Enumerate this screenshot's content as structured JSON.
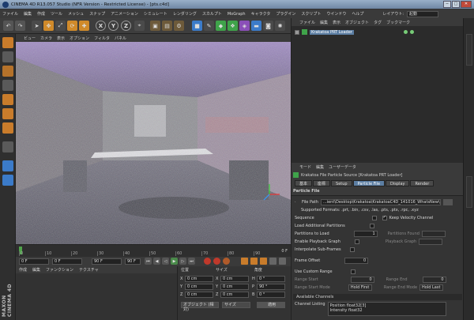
{
  "window": {
    "title": "CINEMA 4D R13.057 Studio (NFR Version - Restricted License) - [pts.c4d]",
    "min": "─",
    "max": "□",
    "close": "✕"
  },
  "menu": {
    "items": [
      "ファイル",
      "編集",
      "作成",
      "ツール",
      "メッシュ",
      "スナップ",
      "アニメーション",
      "シミュレート",
      "レンダリング",
      "スカルプト",
      "MoGraph",
      "キャラクタ",
      "プラグイン",
      "スクリプト",
      "ウインドウ",
      "ヘルプ"
    ],
    "layout_label": "レイアウト:",
    "layout_value": "起動"
  },
  "toolbar": {
    "icons": [
      "undo-icon",
      "redo-icon",
      "select-icon",
      "move-icon",
      "scale-icon",
      "rotate-icon",
      "add-icon",
      "x-axis-icon",
      "y-axis-icon",
      "z-axis-icon",
      "coord-system-icon",
      "render-region-icon",
      "render-view-icon",
      "render-settings-icon",
      "cube-icon",
      "pen-icon",
      "subdivide-icon",
      "array-icon",
      "deformer-icon",
      "floor-icon",
      "camera-icon",
      "light-icon"
    ],
    "axis_x": "X",
    "axis_y": "Y",
    "axis_z": "Z"
  },
  "viewport": {
    "menu": [
      "ビュー",
      "カメラ",
      "表示",
      "オプション",
      "フィルタ",
      "パネル"
    ],
    "colors": {
      "ceiling": "#8a6fb8",
      "floor": "#5a5a68"
    }
  },
  "timeline": {
    "ticks": [
      "0",
      "10",
      "20",
      "30",
      "40",
      "50",
      "60",
      "70",
      "80",
      "90"
    ],
    "end_frame": "0 F"
  },
  "transport": {
    "start": "0 F",
    "current": "0 F",
    "end": "90 F",
    "end2": "90 F"
  },
  "material_manager": {
    "menu": [
      "作成",
      "編集",
      "ファンクション",
      "テクスチャ"
    ]
  },
  "coordinates": {
    "headers": [
      "位置",
      "サイズ",
      "角度"
    ],
    "rows": [
      {
        "axis": "X",
        "pos": "0 cm",
        "size": "0 cm",
        "ang_axis": "H",
        "ang": "0 °"
      },
      {
        "axis": "Y",
        "pos": "0 cm",
        "size": "0 cm",
        "ang_axis": "P",
        "ang": "90 °"
      },
      {
        "axis": "Z",
        "pos": "0 cm",
        "size": "0 cm",
        "ang_axis": "B",
        "ang": "0 °"
      }
    ],
    "mode": "オブジェクト (相対)",
    "size_mode": "サイズ",
    "apply": "適用"
  },
  "objects": {
    "menu": [
      "ファイル",
      "編集",
      "表示",
      "オブジェクト",
      "タグ",
      "ブックマーク"
    ],
    "items": [
      {
        "name": "Krakatoa PRT Loader"
      }
    ]
  },
  "attributes": {
    "menu": [
      "モード",
      "編集",
      "ユーザーデータ"
    ],
    "object_title": "Krakatoa File Particle Source [Krakatoa PRT Loader]",
    "tabs": [
      "基本",
      "座標",
      "Setup",
      "Particle File",
      "Display",
      "Render"
    ],
    "active_tab": "Particle File",
    "section": "Particle File",
    "file_path_label": "File Path",
    "file_path": "...ient\\Desktop\\Krakatoa\\KrakatoaC4D_141016_WhatsNew\\particle\\Recap.pts",
    "supported_formats": "Supported Formats: .prt, .bin, .csv, .las, .pts, .ptx, .rpc, .xyz",
    "sequence": "Sequence",
    "keep_velocity": "Keep Velocity Channel",
    "load_additional": "Load Additional Partitions",
    "partitions_to_load": "Partitions to Load",
    "partitions_value": "1",
    "partitions_found": "Partitions Found",
    "enable_playback_graph": "Enable Playback Graph",
    "playback_graph": "Playback Graph",
    "interpolate": "Interpolate Sub-Frames",
    "frame_offset": "Frame Offset",
    "frame_offset_value": "0",
    "use_custom_range": "Use Custom Range",
    "range_start": "Range Start",
    "range_start_value": "0",
    "range_end": "Range End",
    "range_end_value": "0",
    "range_start_mode": "Range Start Mode",
    "range_start_mode_value": "Hold First",
    "range_end_mode": "Range End Mode",
    "range_end_mode_value": "Hold Last",
    "available_channels": "Available Channels",
    "channel_listing": "Channel Listing",
    "channels": [
      "Position float32[3]",
      "Intensity float32"
    ]
  },
  "branding": {
    "logo": "MAXON CINEMA 4D"
  }
}
